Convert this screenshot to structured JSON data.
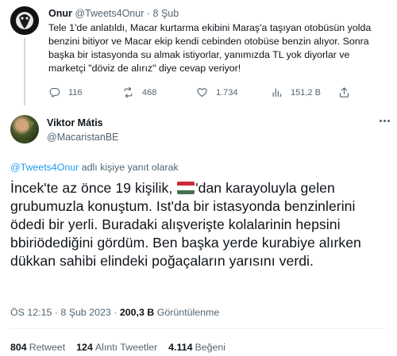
{
  "parent_tweet": {
    "author_name": "Onur",
    "author_handle": "@Tweets4Onur",
    "separator": "·",
    "date": "8 Şub",
    "text": "Tele 1'de anlatıldı, Macar kurtarma ekibini Maraş'a taşıyan otobüsün yolda benzini bitiyor ve Macar ekip kendi cebinden otobüse benzin alıyor. Sonra başka bir istasyonda su almak istiyorlar, yanımızda TL yok diyorlar ve marketçi \"döviz de alırız\" diye cevap veriyor!",
    "actions": {
      "replies": "116",
      "retweets": "468",
      "likes": "1.734",
      "views": "151,2 B"
    }
  },
  "main_tweet": {
    "author_name": "Viktor Mátis",
    "author_handle": "@MacaristanBE",
    "reply_mention": "@Tweets4Onur",
    "reply_suffix": "adlı kişiye yanıt olarak",
    "text_before_flag": "İncek'te az önce 19 kişilik,",
    "flag_emoji": "hungary-flag",
    "text_after_flag": "'dan karayoluyla gelen grubumuzla konuştum. Ist'da bir istasyonda benzinlerini ödedi bir yerli. Buradaki alışverişte kolalarinin hepsini bbiriödediğini gördüm. Ben başka yerde kurabiye alırken dükkan sahibi elindeki poğaçaların yarısını verdi.",
    "time": "ÖS 12:15",
    "separator": "·",
    "date": "8 Şub 2023",
    "views_count": "200,3 B",
    "views_label": "Görüntülenme",
    "retweets_count": "804",
    "retweets_label": "Retweet",
    "quotes_count": "124",
    "quotes_label": "Alıntı Tweetler",
    "likes_count": "4.114",
    "likes_label": "Beğeni"
  },
  "colors": {
    "text": "#0f1419",
    "secondary": "#536471",
    "link": "#1d9bf0",
    "flag_red": "#ce2939",
    "flag_white": "#ffffff",
    "flag_green": "#477050"
  }
}
